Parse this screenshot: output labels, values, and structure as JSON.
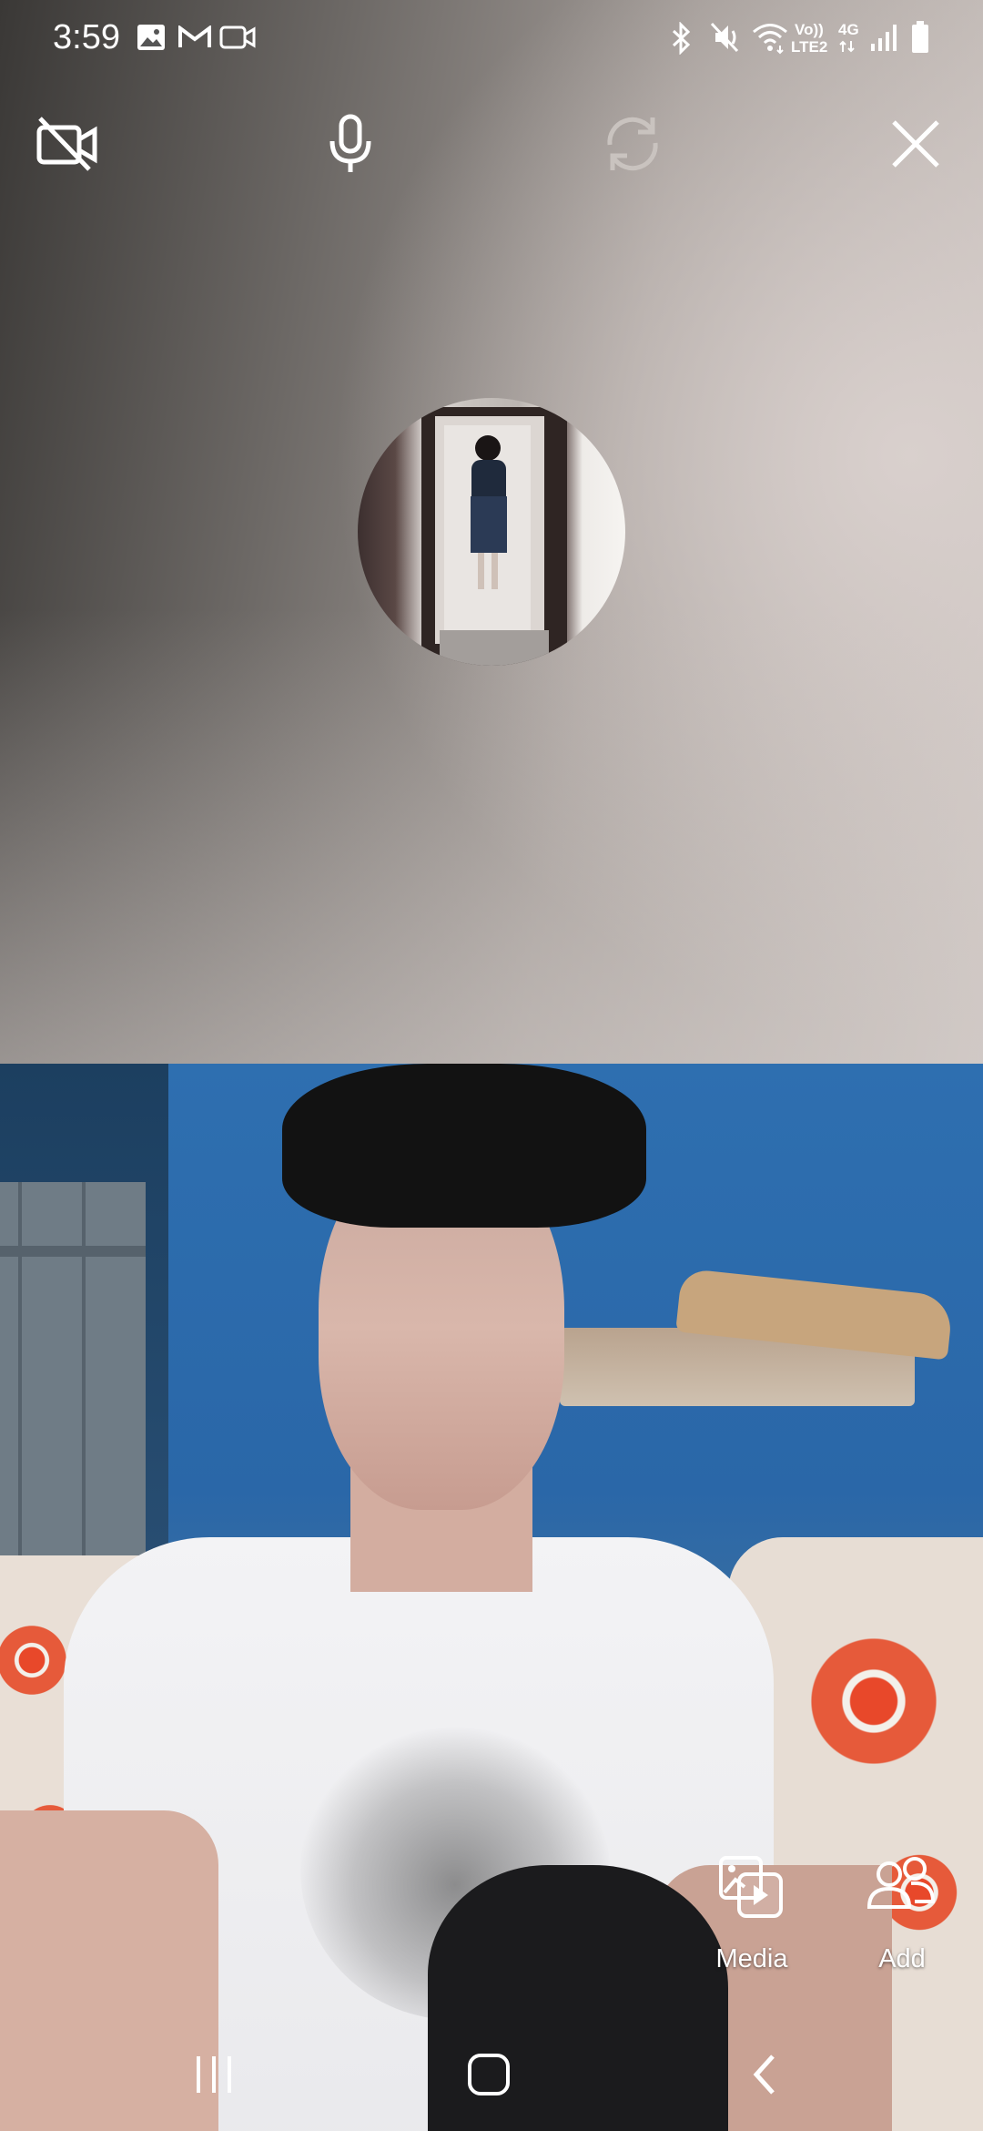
{
  "status_bar": {
    "time": "3:59",
    "icons_left": [
      "image-icon",
      "gmail-icon",
      "video-camera-icon"
    ],
    "icons_right": [
      "bluetooth-icon",
      "mute-vibrate-icon",
      "wifi-icon",
      "volte-icon",
      "4g-icon",
      "signal-icon",
      "battery-icon"
    ],
    "volte_line1": "Vo))",
    "volte_line2": "LTE2",
    "network_label": "4G"
  },
  "call_controls": {
    "camera_off": "camera-off-icon",
    "microphone": "microphone-icon",
    "flip_camera": "flip-camera-icon",
    "end": "close-icon"
  },
  "side_actions": {
    "media_label": "Media",
    "add_label": "Add"
  },
  "nav_bar": {
    "recents": "recents-icon",
    "home": "home-icon",
    "back": "back-icon"
  },
  "colors": {
    "icon_white": "#ffffff",
    "icon_disabled": "#b8b2ae"
  }
}
